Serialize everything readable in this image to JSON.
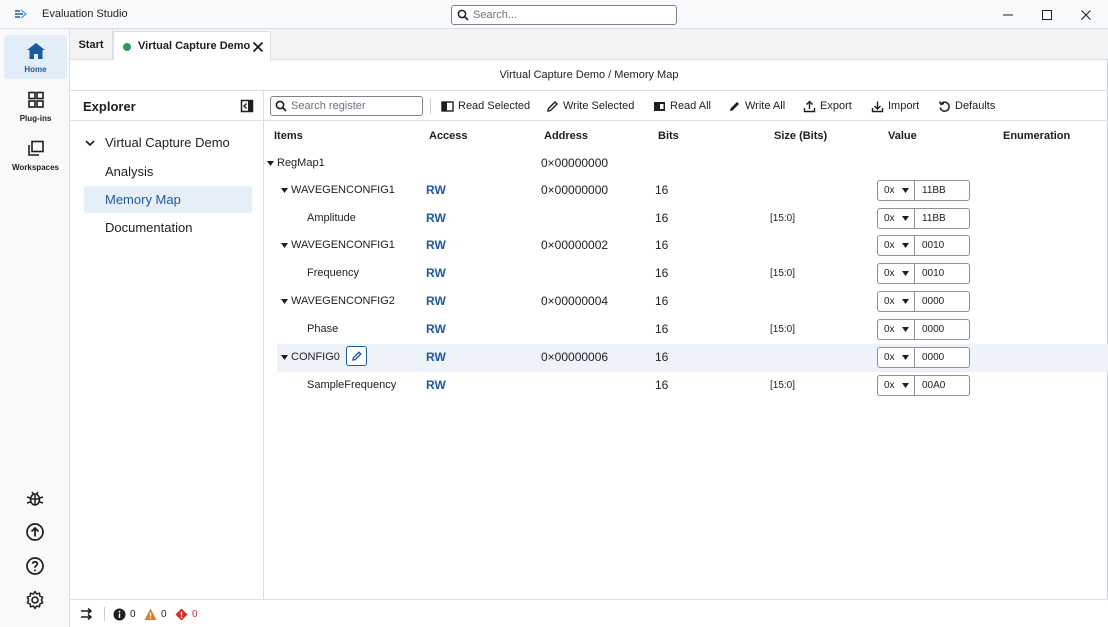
{
  "window": {
    "title": "Evaluation Studio",
    "search_placeholder": "Search..."
  },
  "rail": {
    "items": [
      {
        "label": "Home",
        "icon": "home-icon",
        "active": true
      },
      {
        "label": "Plug-ins",
        "icon": "grid-icon",
        "active": false
      },
      {
        "label": "Workspaces",
        "icon": "workspaces-icon",
        "active": false
      }
    ],
    "bottom_icons": [
      "bug-icon",
      "upload-icon",
      "help-icon",
      "settings-icon"
    ]
  },
  "tabs": {
    "start_label": "Start",
    "active_label": "Virtual Capture Demo",
    "active_status_color": "#2e9a55"
  },
  "breadcrumb": "Virtual Capture Demo / Memory Map",
  "explorer": {
    "title": "Explorer",
    "root": "Virtual Capture Demo",
    "items": [
      {
        "label": "Analysis",
        "selected": false
      },
      {
        "label": "Memory Map",
        "selected": true
      },
      {
        "label": "Documentation",
        "selected": false
      }
    ]
  },
  "toolbar": {
    "search_placeholder": "Search register",
    "read_selected": "Read Selected",
    "write_selected": "Write Selected",
    "read_all": "Read All",
    "write_all": "Write All",
    "export": "Export",
    "import": "Import",
    "defaults": "Defaults"
  },
  "table": {
    "headers": {
      "items": "Items",
      "access": "Access",
      "address": "Address",
      "bits": "Bits",
      "size": "Size (Bits)",
      "value": "Value",
      "enumeration": "Enumeration"
    },
    "rows": [
      {
        "name": "RegMap1",
        "level": 0,
        "expandable": true,
        "access": "",
        "address": "0×00000000",
        "bits": "",
        "size": "",
        "prefix": "",
        "value": ""
      },
      {
        "name": "WAVEGENCONFIG1",
        "level": 1,
        "expandable": true,
        "access": "RW",
        "address": "0×00000000",
        "bits": "16",
        "size": "",
        "prefix": "0x",
        "value": "11BB"
      },
      {
        "name": "Amplitude",
        "level": 2,
        "expandable": false,
        "access": "RW",
        "address": "",
        "bits": "16",
        "size": "[15:0]",
        "prefix": "0x",
        "value": "11BB"
      },
      {
        "name": "WAVEGENCONFIG1",
        "level": 1,
        "expandable": true,
        "access": "RW",
        "address": "0×00000002",
        "bits": "16",
        "size": "",
        "prefix": "0x",
        "value": "0010"
      },
      {
        "name": "Frequency",
        "level": 2,
        "expandable": false,
        "access": "RW",
        "address": "",
        "bits": "16",
        "size": "[15:0]",
        "prefix": "0x",
        "value": "0010"
      },
      {
        "name": "WAVEGENCONFIG2",
        "level": 1,
        "expandable": true,
        "access": "RW",
        "address": "0×00000004",
        "bits": "16",
        "size": "",
        "prefix": "0x",
        "value": "0000"
      },
      {
        "name": "Phase",
        "level": 2,
        "expandable": false,
        "access": "RW",
        "address": "",
        "bits": "16",
        "size": "[15:0]",
        "prefix": "0x",
        "value": "0000"
      },
      {
        "name": "CONFIG0",
        "level": 1,
        "expandable": true,
        "access": "RW",
        "address": "0×00000006",
        "bits": "16",
        "size": "",
        "prefix": "0x",
        "value": "0000",
        "highlighted": true,
        "edit_icon": "pencil-icon"
      },
      {
        "name": "SampleFrequency",
        "level": 2,
        "expandable": false,
        "access": "RW",
        "address": "",
        "bits": "16",
        "size": "[15:0]",
        "prefix": "0x",
        "value": "00A0"
      }
    ]
  },
  "status": {
    "info_count": "0",
    "warning_count": "0",
    "error_count": "0",
    "colors": {
      "info": "#1e1e1e",
      "warning": "#e8761c",
      "error": "#d62c2c"
    }
  },
  "colors": {
    "accent": "#1c5a9e",
    "selection": "#e6eef8"
  }
}
